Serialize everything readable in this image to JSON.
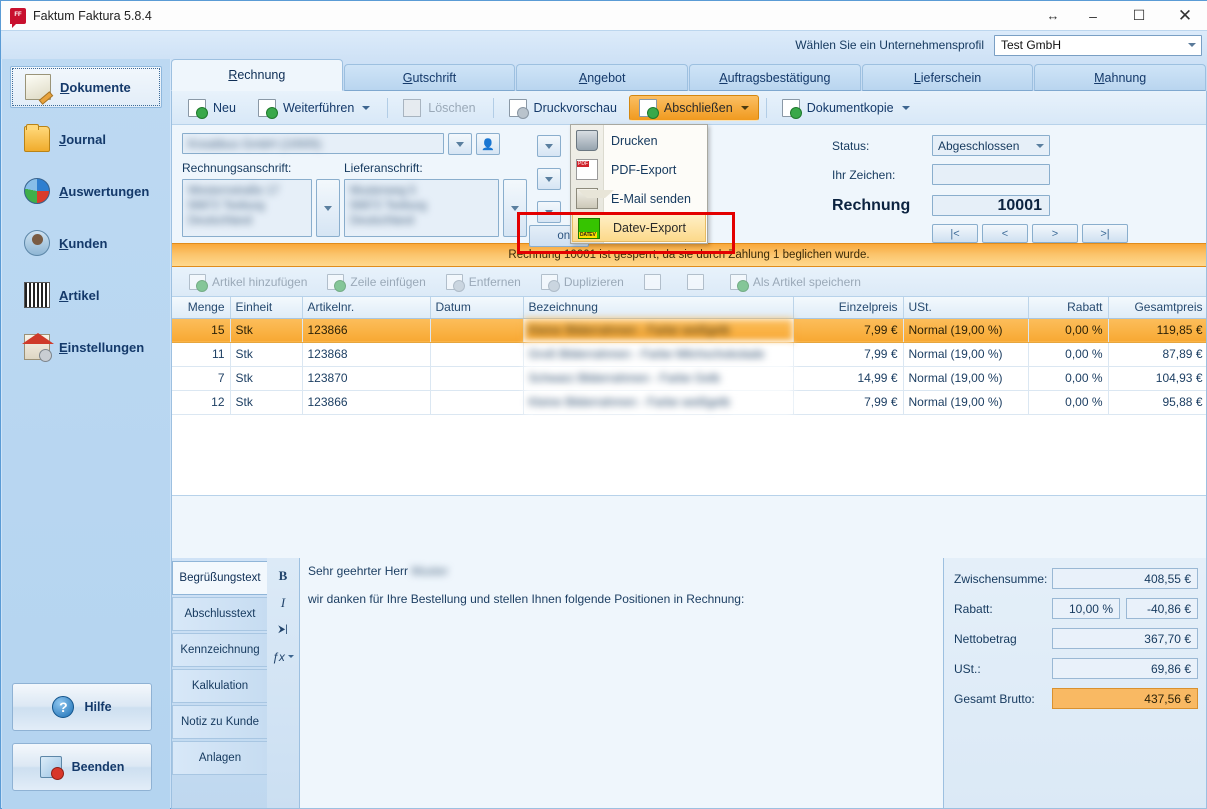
{
  "window": {
    "title": "Faktum Faktura 5.8.4",
    "app_icon": "faktum-logo-icon",
    "controls": {
      "resize": "↔",
      "minimize": "–",
      "maximize": "☐",
      "close": "✕"
    }
  },
  "profile_bar": {
    "label": "Wählen Sie ein Unternehmensprofil",
    "selected": "Test GmbH"
  },
  "sidebar": {
    "items": [
      {
        "label": "Dokumente",
        "accel": "D",
        "icon": "document-icon",
        "active": true
      },
      {
        "label": "Journal",
        "accel": "J",
        "icon": "folder-icon",
        "active": false
      },
      {
        "label": "Auswertungen",
        "accel": "A",
        "icon": "pie-chart-icon",
        "active": false
      },
      {
        "label": "Kunden",
        "accel": "K",
        "icon": "user-icon",
        "active": false
      },
      {
        "label": "Artikel",
        "accel": "A",
        "icon": "barcode-icon",
        "active": false
      },
      {
        "label": "Einstellungen",
        "accel": "E",
        "icon": "house-gear-icon",
        "active": false
      }
    ],
    "buttons": [
      {
        "label": "Hilfe",
        "icon": "help-icon"
      },
      {
        "label": "Beenden",
        "icon": "exit-icon"
      }
    ]
  },
  "tabs": [
    {
      "label": "Rechnung",
      "accel": "R",
      "active": true
    },
    {
      "label": "Gutschrift",
      "accel": "G",
      "active": false
    },
    {
      "label": "Angebot",
      "accel": "A",
      "active": false
    },
    {
      "label": "Auftragsbestätigung",
      "accel": "A",
      "active": false
    },
    {
      "label": "Lieferschein",
      "accel": "L",
      "active": false
    },
    {
      "label": "Mahnung",
      "accel": "M",
      "active": false
    }
  ],
  "toolbar": {
    "new": "Neu",
    "continue": "Weiterführen",
    "delete": "Löschen",
    "preview": "Druckvorschau",
    "complete": "Abschließen",
    "doc_copy": "Dokumentkopie"
  },
  "menu": {
    "items": [
      {
        "label": "Drucken",
        "icon": "printer-icon",
        "selected": false
      },
      {
        "label": "PDF-Export",
        "icon": "pdf-icon",
        "selected": false
      },
      {
        "label": "E-Mail senden",
        "icon": "envelope-icon",
        "selected": false
      },
      {
        "label": "Datev-Export",
        "icon": "datev-icon",
        "selected": true
      }
    ]
  },
  "form": {
    "customer": "Kreatibus GmbH (10005)",
    "billing_label": "Rechnungsanschrift:",
    "billing_address": "Westernstraße 17\n56872 Teeburg\nDeutschland",
    "shipping_label": "Lieferanschrift:",
    "shipping_address": "Musterweg 5\n56872 Teeburg\nDeutschland",
    "hidden_button": "onen",
    "status_label": "Status:",
    "status_value": "Abgeschlossen",
    "reference_label": "Ihr Zeichen:",
    "reference_value": "",
    "doc_type": "Rechnung",
    "doc_number": "10001",
    "nav": [
      "|<",
      "<",
      ">",
      ">|"
    ]
  },
  "banner": {
    "text": "Rechnung 10001 ist gesperrt, da sie durch Zahlung 1 beglichen wurde."
  },
  "item_toolbar": [
    {
      "label": "Artikel hinzufügen",
      "icon": "add-article-icon"
    },
    {
      "label": "Zeile einfügen",
      "icon": "insert-row-icon"
    },
    {
      "label": "Entfernen",
      "icon": "remove-icon"
    },
    {
      "label": "Duplizieren",
      "icon": "duplicate-icon"
    },
    {
      "label": "",
      "icon": "move-up-icon"
    },
    {
      "label": "",
      "icon": "move-down-icon"
    },
    {
      "label": "Als Artikel speichern",
      "icon": "save-article-icon"
    }
  ],
  "table": {
    "columns": [
      "Menge",
      "Einheit",
      "Artikelnr.",
      "Datum",
      "Bezeichnung",
      "Einzelpreis",
      "USt.",
      "Rabatt",
      "Gesamtpreis"
    ],
    "rows": [
      {
        "menge": "15",
        "einheit": "Stk",
        "artikelnr": "123866",
        "datum": "",
        "bezeichnung": "Kleine Bilderrahmen - Farbe weißgelb",
        "einzelpreis": "7,99 €",
        "ust": "Normal (19,00 %)",
        "rabatt": "0,00 %",
        "gesamtpreis": "119,85 €",
        "selected": true
      },
      {
        "menge": "11",
        "einheit": "Stk",
        "artikelnr": "123868",
        "datum": "",
        "bezeichnung": "Groß Bilderrahmen - Farbe Milchschokolade",
        "einzelpreis": "7,99 €",
        "ust": "Normal (19,00 %)",
        "rabatt": "0,00 %",
        "gesamtpreis": "87,89 €",
        "selected": false
      },
      {
        "menge": "7",
        "einheit": "Stk",
        "artikelnr": "123870",
        "datum": "",
        "bezeichnung": "Schwarz Bilderrahmen - Farbe Gelb",
        "einzelpreis": "14,99 €",
        "ust": "Normal (19,00 %)",
        "rabatt": "0,00 %",
        "gesamtpreis": "104,93 €",
        "selected": false
      },
      {
        "menge": "12",
        "einheit": "Stk",
        "artikelnr": "123866",
        "datum": "",
        "bezeichnung": "Kleine Bilderrahmen - Farbe weißgelb",
        "einzelpreis": "7,99 €",
        "ust": "Normal (19,00 %)",
        "rabatt": "0,00 %",
        "gesamtpreis": "95,88 €",
        "selected": false
      }
    ]
  },
  "text_tabs": [
    {
      "label": "Begrüßungstext",
      "active": true
    },
    {
      "label": "Abschlusstext",
      "active": false
    },
    {
      "label": "Kennzeichnung",
      "active": false
    },
    {
      "label": "Kalkulation",
      "active": false
    },
    {
      "label": "Notiz zu Kunde",
      "active": false
    },
    {
      "label": "Anlagen",
      "active": false
    }
  ],
  "editor": {
    "tools": [
      {
        "glyph": "B",
        "icon": "bold-icon"
      },
      {
        "glyph": "I",
        "icon": "italic-icon"
      },
      {
        "glyph": "⮞|",
        "icon": "indent-icon"
      },
      {
        "glyph": "ƒx",
        "icon": "function-icon"
      }
    ],
    "greeting_prefix": "Sehr geehrter Herr ",
    "greeting_name": "Muster",
    "body": "wir danken für Ihre Bestellung und stellen Ihnen folgende Positionen in Rechnung:"
  },
  "totals": {
    "subtotal_label": "Zwischensumme:",
    "subtotal_value": "408,55 €",
    "discount_label": "Rabatt:",
    "discount_pct": "10,00 %",
    "discount_value": "-40,86 €",
    "net_label": "Nettobetrag",
    "net_value": "367,70 €",
    "vat_label": "USt.:",
    "vat_value": "69,86 €",
    "gross_label": "Gesamt Brutto:",
    "gross_value": "437,56 €"
  },
  "colors": {
    "accent_orange": "#f8a832",
    "annotation_red": "#e30000",
    "menu_highlight": "#fcd98a",
    "text_blue": "#15395e"
  }
}
